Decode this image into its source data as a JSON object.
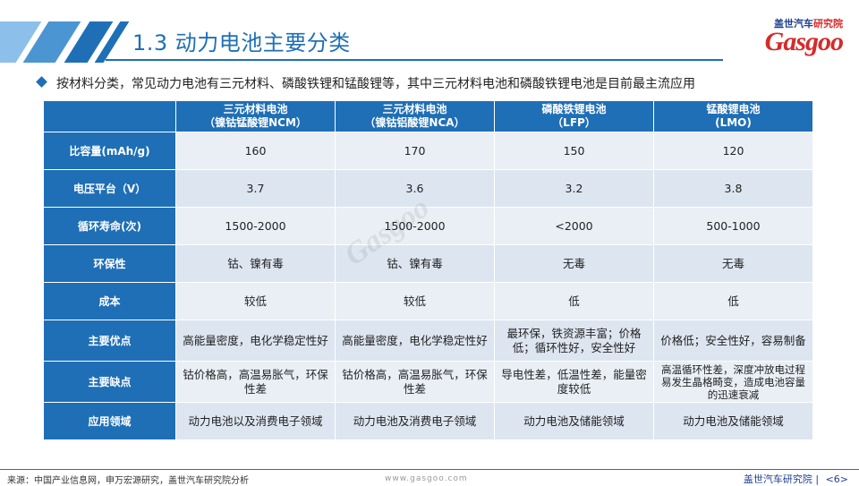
{
  "header": {
    "title": "1.3 动力电池主要分类",
    "logo_cn_a": "盖世汽车",
    "logo_cn_b": "研究院",
    "logo_en": "Gasgoo"
  },
  "intro": "按材料分类，常见动力电池有三元材料、磷酸铁锂和锰酸锂等，其中三元材料电池和磷酸铁锂电池是目前最主流应用",
  "table": {
    "columns": [
      {
        "line1": "三元材料电池",
        "line2": "（镍钴锰酸锂NCM）"
      },
      {
        "line1": "三元材料电池",
        "line2": "（镍钴铝酸锂NCA）"
      },
      {
        "line1": "磷酸铁锂电池",
        "line2": "（LFP）"
      },
      {
        "line1": "锰酸锂电池",
        "line2": "(LMO)"
      }
    ],
    "rows": [
      {
        "label": "比容量(mAh/g)",
        "cells": [
          "160",
          "170",
          "150",
          "120"
        ]
      },
      {
        "label": "电压平台（V）",
        "cells": [
          "3.7",
          "3.6",
          "3.2",
          "3.8"
        ]
      },
      {
        "label": "循环寿命(次)",
        "cells": [
          "1500-2000",
          "1500-2000",
          "<2000",
          "500-1000"
        ]
      },
      {
        "label": "环保性",
        "cells": [
          "钴、镍有毒",
          "钴、镍有毒",
          "无毒",
          "无毒"
        ]
      },
      {
        "label": "成本",
        "cells": [
          "较低",
          "较低",
          "低",
          "低"
        ]
      },
      {
        "label": "主要优点",
        "cells": [
          "高能量密度，电化学稳定性好",
          "高能量密度，电化学稳定性好",
          "最环保，铁资源丰富；价格低；循环性好，安全性好",
          "价格低；安全性好，容易制备"
        ]
      },
      {
        "label": "主要缺点",
        "cells": [
          "钴价格高，高温易胀气，环保性差",
          "钴价格高，高温易胀气，环保性差",
          "导电性差，低温性差，能量密度较低",
          "高温循环性差，深度冲放电过程易发生晶格畸变，造成电池容量的迅速衰减"
        ]
      },
      {
        "label": "应用领域",
        "cells": [
          "动力电池以及消费电子领域",
          "动力电池及消费电子领域",
          "动力电池及储能领域",
          "动力电池及储能领域"
        ]
      }
    ]
  },
  "footer": {
    "source": "来源：中国产业信息网，申万宏源研究，盖世汽车研究院分析",
    "url": "www.gasgoo.com",
    "brand": "盖世汽车研究院",
    "page": "<6>"
  },
  "colors": {
    "accent": "#1f6fb6",
    "brand_red": "#d62a2a"
  }
}
